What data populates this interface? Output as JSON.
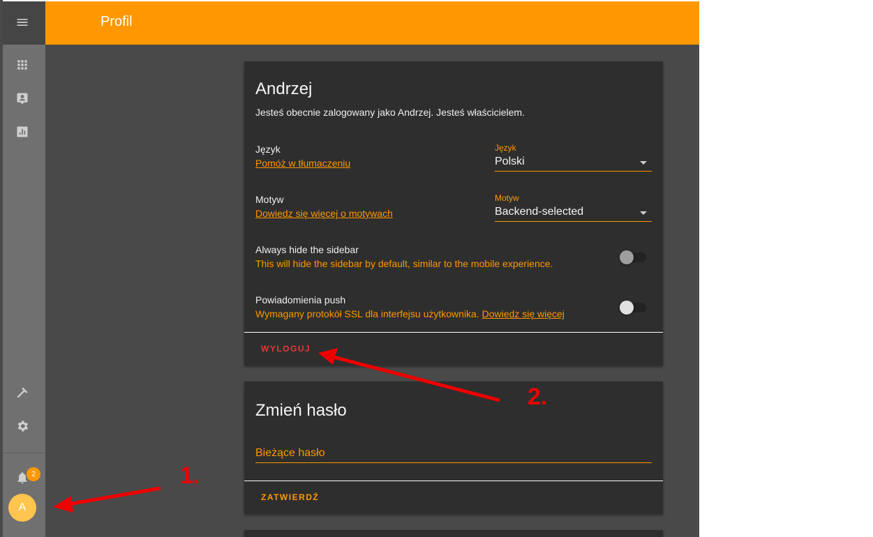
{
  "header": {
    "title": "Profil"
  },
  "sidebar": {
    "icons": [
      "menu-icon",
      "apps-grid-icon",
      "account-box-icon",
      "bar-chart-icon",
      "hammer-icon",
      "gear-icon",
      "bell-icon"
    ],
    "notification_count": "2",
    "avatar_letter": "A"
  },
  "profile_card": {
    "name": "Andrzej",
    "status": "Jesteś obecnie zalogowany jako Andrzej. Jesteś właścicielem.",
    "language": {
      "label": "Język",
      "help_link": "Pomóż w tłumaczeniu",
      "select_label": "Język",
      "select_value": "Polski"
    },
    "theme": {
      "label": "Motyw",
      "help_link": "Dowiedz się więcej o motywach",
      "select_label": "Motyw",
      "select_value": "Backend-selected"
    },
    "hide_sidebar": {
      "label": "Always hide the sidebar",
      "description": "This will hide the sidebar by default, similar to the mobile experience.",
      "enabled": false
    },
    "push": {
      "label": "Powiadomienia push",
      "description": "Wymagany protokół SSL dla interfejsu użytkownika.",
      "link": "Dowiedz się więcej",
      "enabled": false
    },
    "logout_label": "WYLOGUJ"
  },
  "password_card": {
    "title": "Zmień hasło",
    "current_password_placeholder": "Bieżące hasło",
    "submit_label": "ZATWIERDŹ"
  },
  "annotations": {
    "first": "1.",
    "second": "2."
  },
  "colors": {
    "accent": "#ff9800",
    "logout": "#e53935",
    "annotation": "#ee0000"
  }
}
